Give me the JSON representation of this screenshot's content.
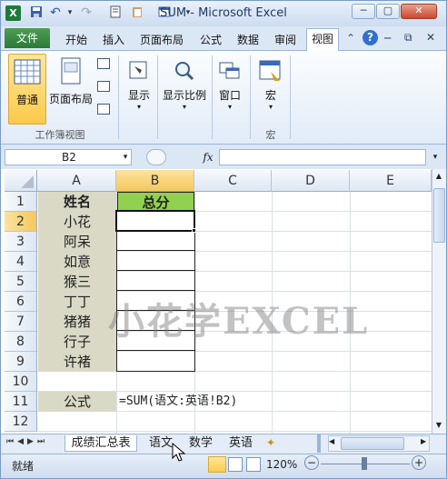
{
  "window": {
    "title": "SUM - Microsoft Excel",
    "minimize": "─",
    "restore": "▢",
    "close": "✕"
  },
  "quick_access": {
    "save": "💾",
    "undo": "↶",
    "redo": "↷",
    "more": "▾"
  },
  "tabs": [
    "开始",
    "插入",
    "页面布局",
    "公式",
    "数据",
    "审阅",
    "视图"
  ],
  "file_tab": "文件",
  "ribbon": {
    "normal": "普通",
    "page_layout": "页面布局",
    "show": "显示",
    "zoom": "显示比例",
    "window": "窗口",
    "macro": "宏",
    "group_workbook_views": "工作簿视图",
    "group_macro": "宏"
  },
  "formula_bar": {
    "name_box": "B2",
    "fx": "fx",
    "formula": ""
  },
  "columns": [
    "A",
    "B",
    "C",
    "D",
    "E"
  ],
  "rows": [
    "1",
    "2",
    "3",
    "4",
    "5",
    "6",
    "7",
    "8",
    "9",
    "10",
    "11",
    "12"
  ],
  "cells": {
    "A1": "姓名",
    "B1": "总分",
    "A2": "小花",
    "A3": "阿呆",
    "A4": "如意",
    "A5": "猴三",
    "A6": "丁丁",
    "A7": "猪猪",
    "A8": "行子",
    "A9": "许褚",
    "A11": "公式",
    "B11": "=SUM(语文:英语!B2)"
  },
  "watermark": "小花学EXCEL",
  "sheets": [
    "成绩汇总表",
    "语文",
    "数学",
    "英语"
  ],
  "status": {
    "ready": "就绪",
    "zoom": "120%",
    "minus": "−",
    "plus": "+"
  },
  "colors": {
    "header_green": "#92d050",
    "name_fill": "#d9d9c6",
    "formula_fill": "#d9d9c6"
  }
}
